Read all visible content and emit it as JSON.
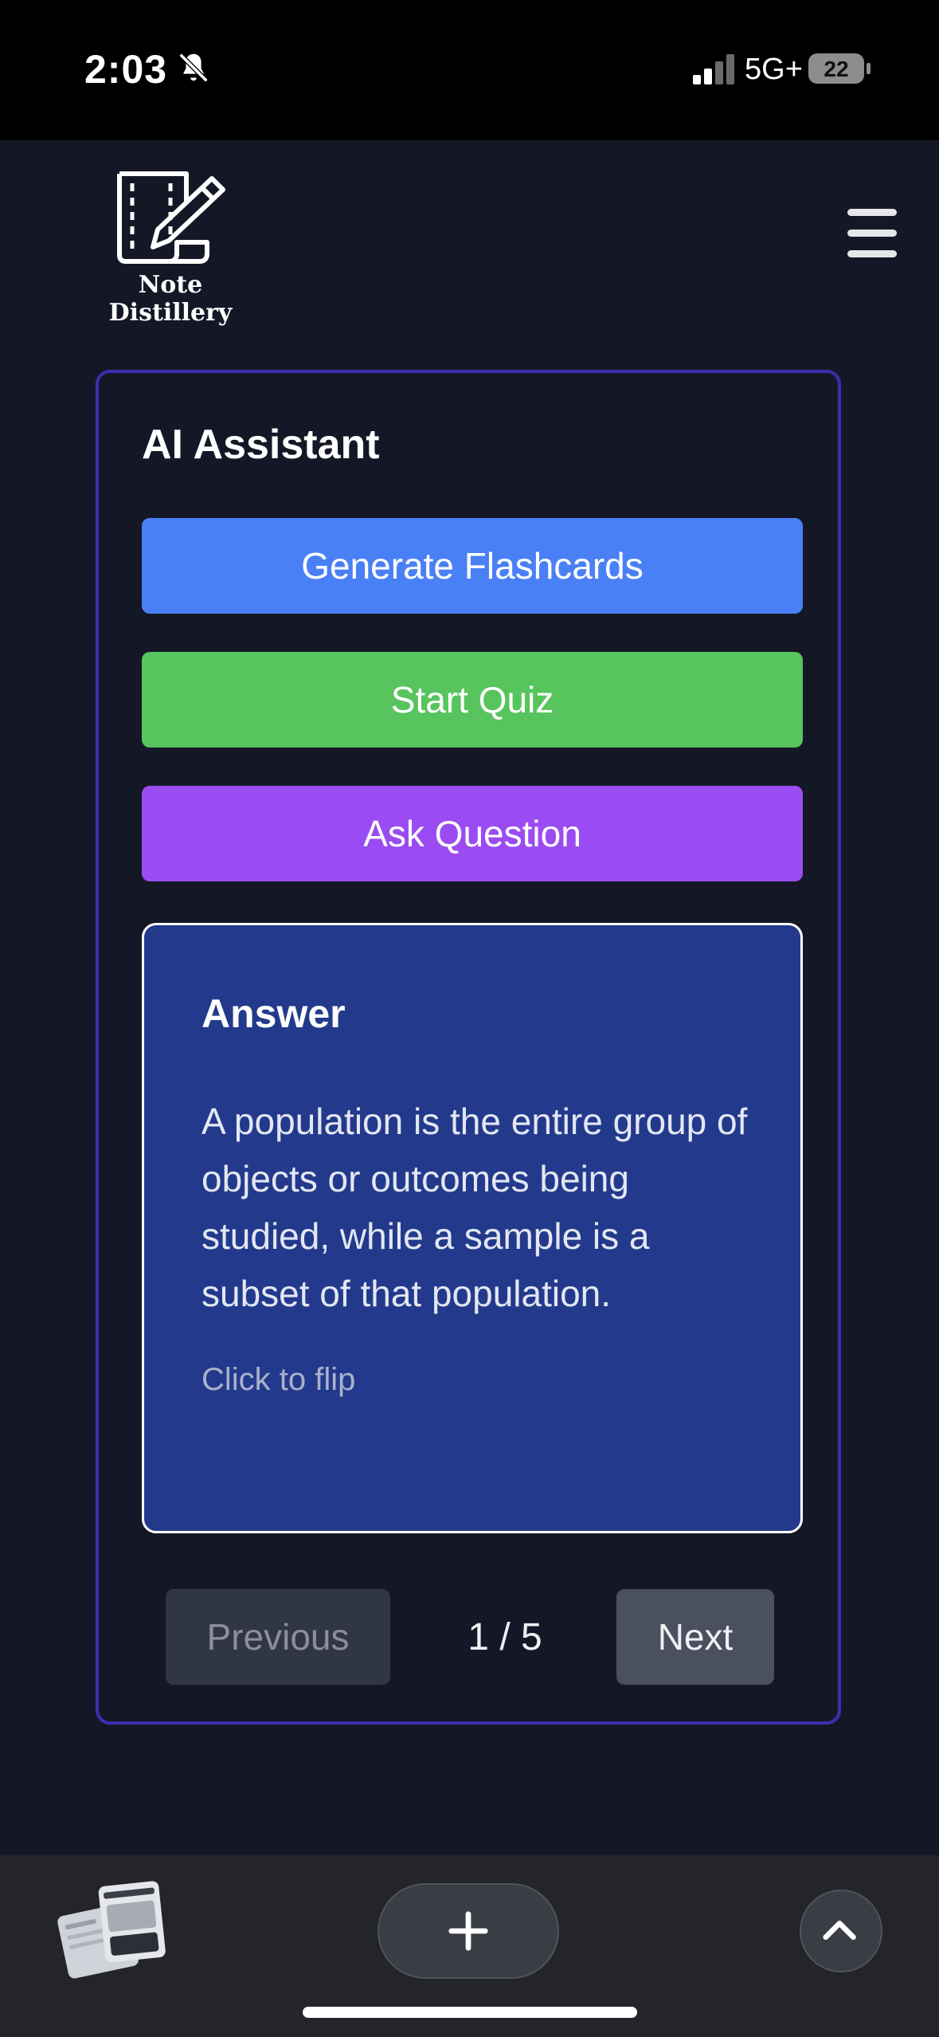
{
  "status_bar": {
    "time": "2:03",
    "network": "5G+",
    "battery": "22",
    "icons": [
      "bell-slash-icon",
      "signal-icon",
      "battery-icon"
    ]
  },
  "header": {
    "brand": "Note Distillery",
    "icons": [
      "notebook-pencil-logo",
      "hamburger-menu-icon"
    ]
  },
  "assistant": {
    "title": "AI Assistant",
    "buttons": {
      "generate": "Generate Flashcards",
      "quiz": "Start Quiz",
      "ask": "Ask Question"
    },
    "flashcard": {
      "heading": "Answer",
      "text": "A population is the entire group of objects or outcomes being studied, while a sample is a subset of that population.",
      "hint": "Click to flip"
    },
    "pager": {
      "previous": "Previous",
      "next": "Next",
      "counter": "1 / 5"
    }
  },
  "colors": {
    "background": "#141826",
    "panel_border": "#3a2fb0",
    "generate": "#4a80f6",
    "quiz": "#57c45d",
    "ask": "#9a4cf2",
    "card": "#233a8c"
  },
  "bottom_bar": {
    "icons": [
      "tabs-thumbnail",
      "plus-icon",
      "chevron-up-icon"
    ]
  }
}
